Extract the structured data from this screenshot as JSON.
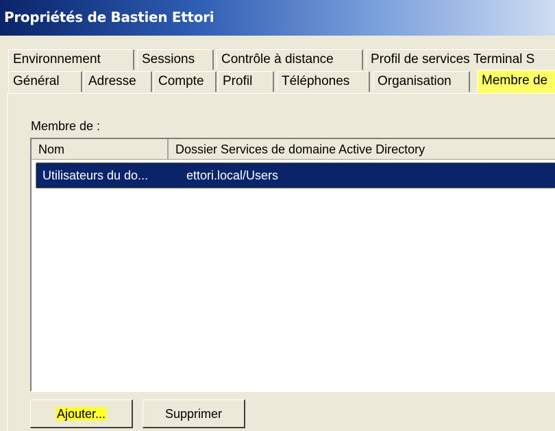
{
  "window": {
    "title": "Propriétés de Bastien Ettori"
  },
  "tabs_row1": [
    {
      "label": "Environnement"
    },
    {
      "label": "Sessions"
    },
    {
      "label": "Contrôle à distance"
    },
    {
      "label": "Profil de services Terminal S"
    }
  ],
  "tabs_row2": [
    {
      "label": "Général"
    },
    {
      "label": "Adresse"
    },
    {
      "label": "Compte"
    },
    {
      "label": "Profil"
    },
    {
      "label": "Téléphones"
    },
    {
      "label": "Organisation"
    },
    {
      "label": "Membre de",
      "active": true
    }
  ],
  "panel": {
    "member_label": "Membre de :",
    "columns": [
      "Nom",
      "Dossier Services de domaine Active Directory"
    ],
    "rows": [
      {
        "name": "Utilisateurs du do...",
        "folder": "ettori.local/Users",
        "selected": true
      }
    ]
  },
  "buttons": {
    "add": "Ajouter...",
    "remove": "Supprimer"
  },
  "colors": {
    "selection": "#0a246a",
    "highlight": "#ffff33",
    "dialog": "#ece9d8"
  }
}
